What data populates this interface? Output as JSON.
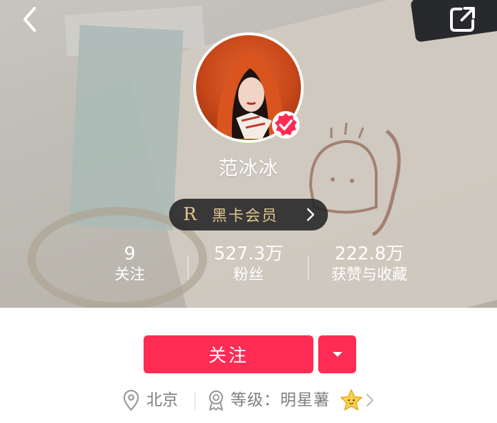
{
  "profile": {
    "nickname": "范冰冰",
    "verified": true
  },
  "vip": {
    "badge_letter": "R",
    "label": "黑卡会员"
  },
  "stats": {
    "following": {
      "value": "9",
      "label": "关注"
    },
    "fans": {
      "value": "527.3万",
      "label": "粉丝"
    },
    "likes": {
      "value": "222.8万",
      "label": "获赞与收藏"
    }
  },
  "actions": {
    "follow_label": "关注"
  },
  "meta": {
    "location": "北京",
    "level_label": "等级：明星薯"
  },
  "icons": {
    "back": "chevron-left-icon",
    "share": "share-external-icon",
    "verified": "verified-check-icon",
    "location": "location-pin-icon",
    "level": "medal-icon",
    "star": "star-icon"
  },
  "colors": {
    "brand_red": "#fe2c55",
    "vip_gold": "#e2c58e",
    "vip_bg": "#232326",
    "meta_text": "#7e7e7e"
  }
}
